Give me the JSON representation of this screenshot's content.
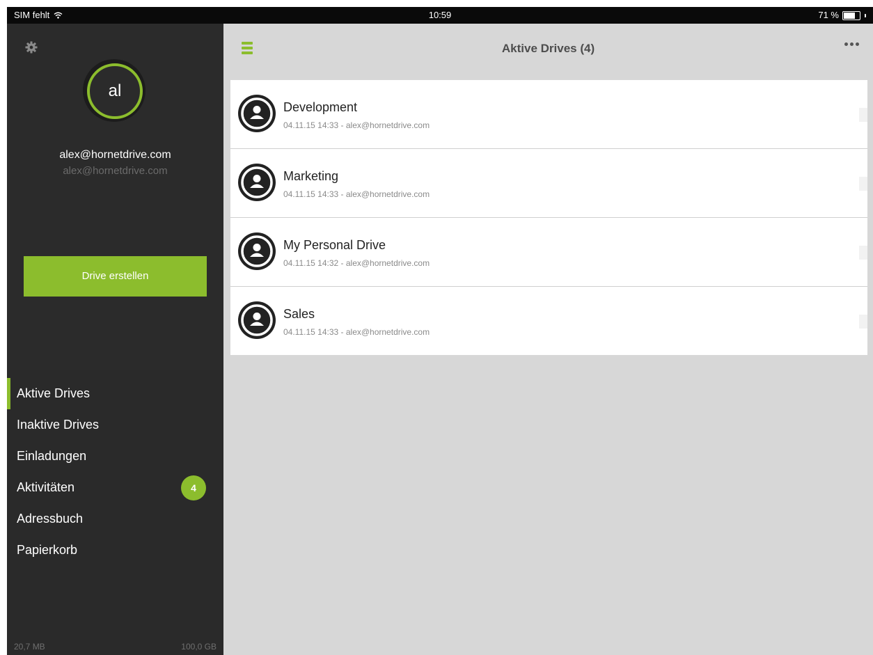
{
  "status_bar": {
    "carrier": "SIM fehlt",
    "time": "10:59",
    "battery": "71 %",
    "battery_level": 0.71
  },
  "sidebar": {
    "settings_icon": "gear-icon",
    "avatar_initials": "al",
    "user_name": "alex@hornetdrive.com",
    "user_email": "alex@hornetdrive.com",
    "create_button": "Drive erstellen",
    "nav": [
      {
        "label": "Aktive Drives",
        "active": true
      },
      {
        "label": "Inaktive Drives"
      },
      {
        "label": "Einladungen"
      },
      {
        "label": "Aktivitäten",
        "badge": "4"
      },
      {
        "label": "Adressbuch"
      },
      {
        "label": "Papierkorb"
      }
    ],
    "storage_used": "20,7 MB",
    "storage_total": "100,0 GB"
  },
  "header": {
    "title": "Aktive Drives (4)",
    "menu_icon": "hamburger-icon",
    "more_icon": "more-icon"
  },
  "drives": [
    {
      "name": "Development",
      "meta": "04.11.15 14:33 - alex@hornetdrive.com"
    },
    {
      "name": "Marketing",
      "meta": "04.11.15 14:33 - alex@hornetdrive.com"
    },
    {
      "name": "My Personal Drive",
      "meta": "04.11.15 14:32 - alex@hornetdrive.com"
    },
    {
      "name": "Sales",
      "meta": "04.11.15 14:33 - alex@hornetdrive.com"
    }
  ],
  "colors": {
    "accent": "#8cbd2d",
    "sidebar_bg": "#2a2a2a",
    "main_bg": "#d7d7d7"
  }
}
